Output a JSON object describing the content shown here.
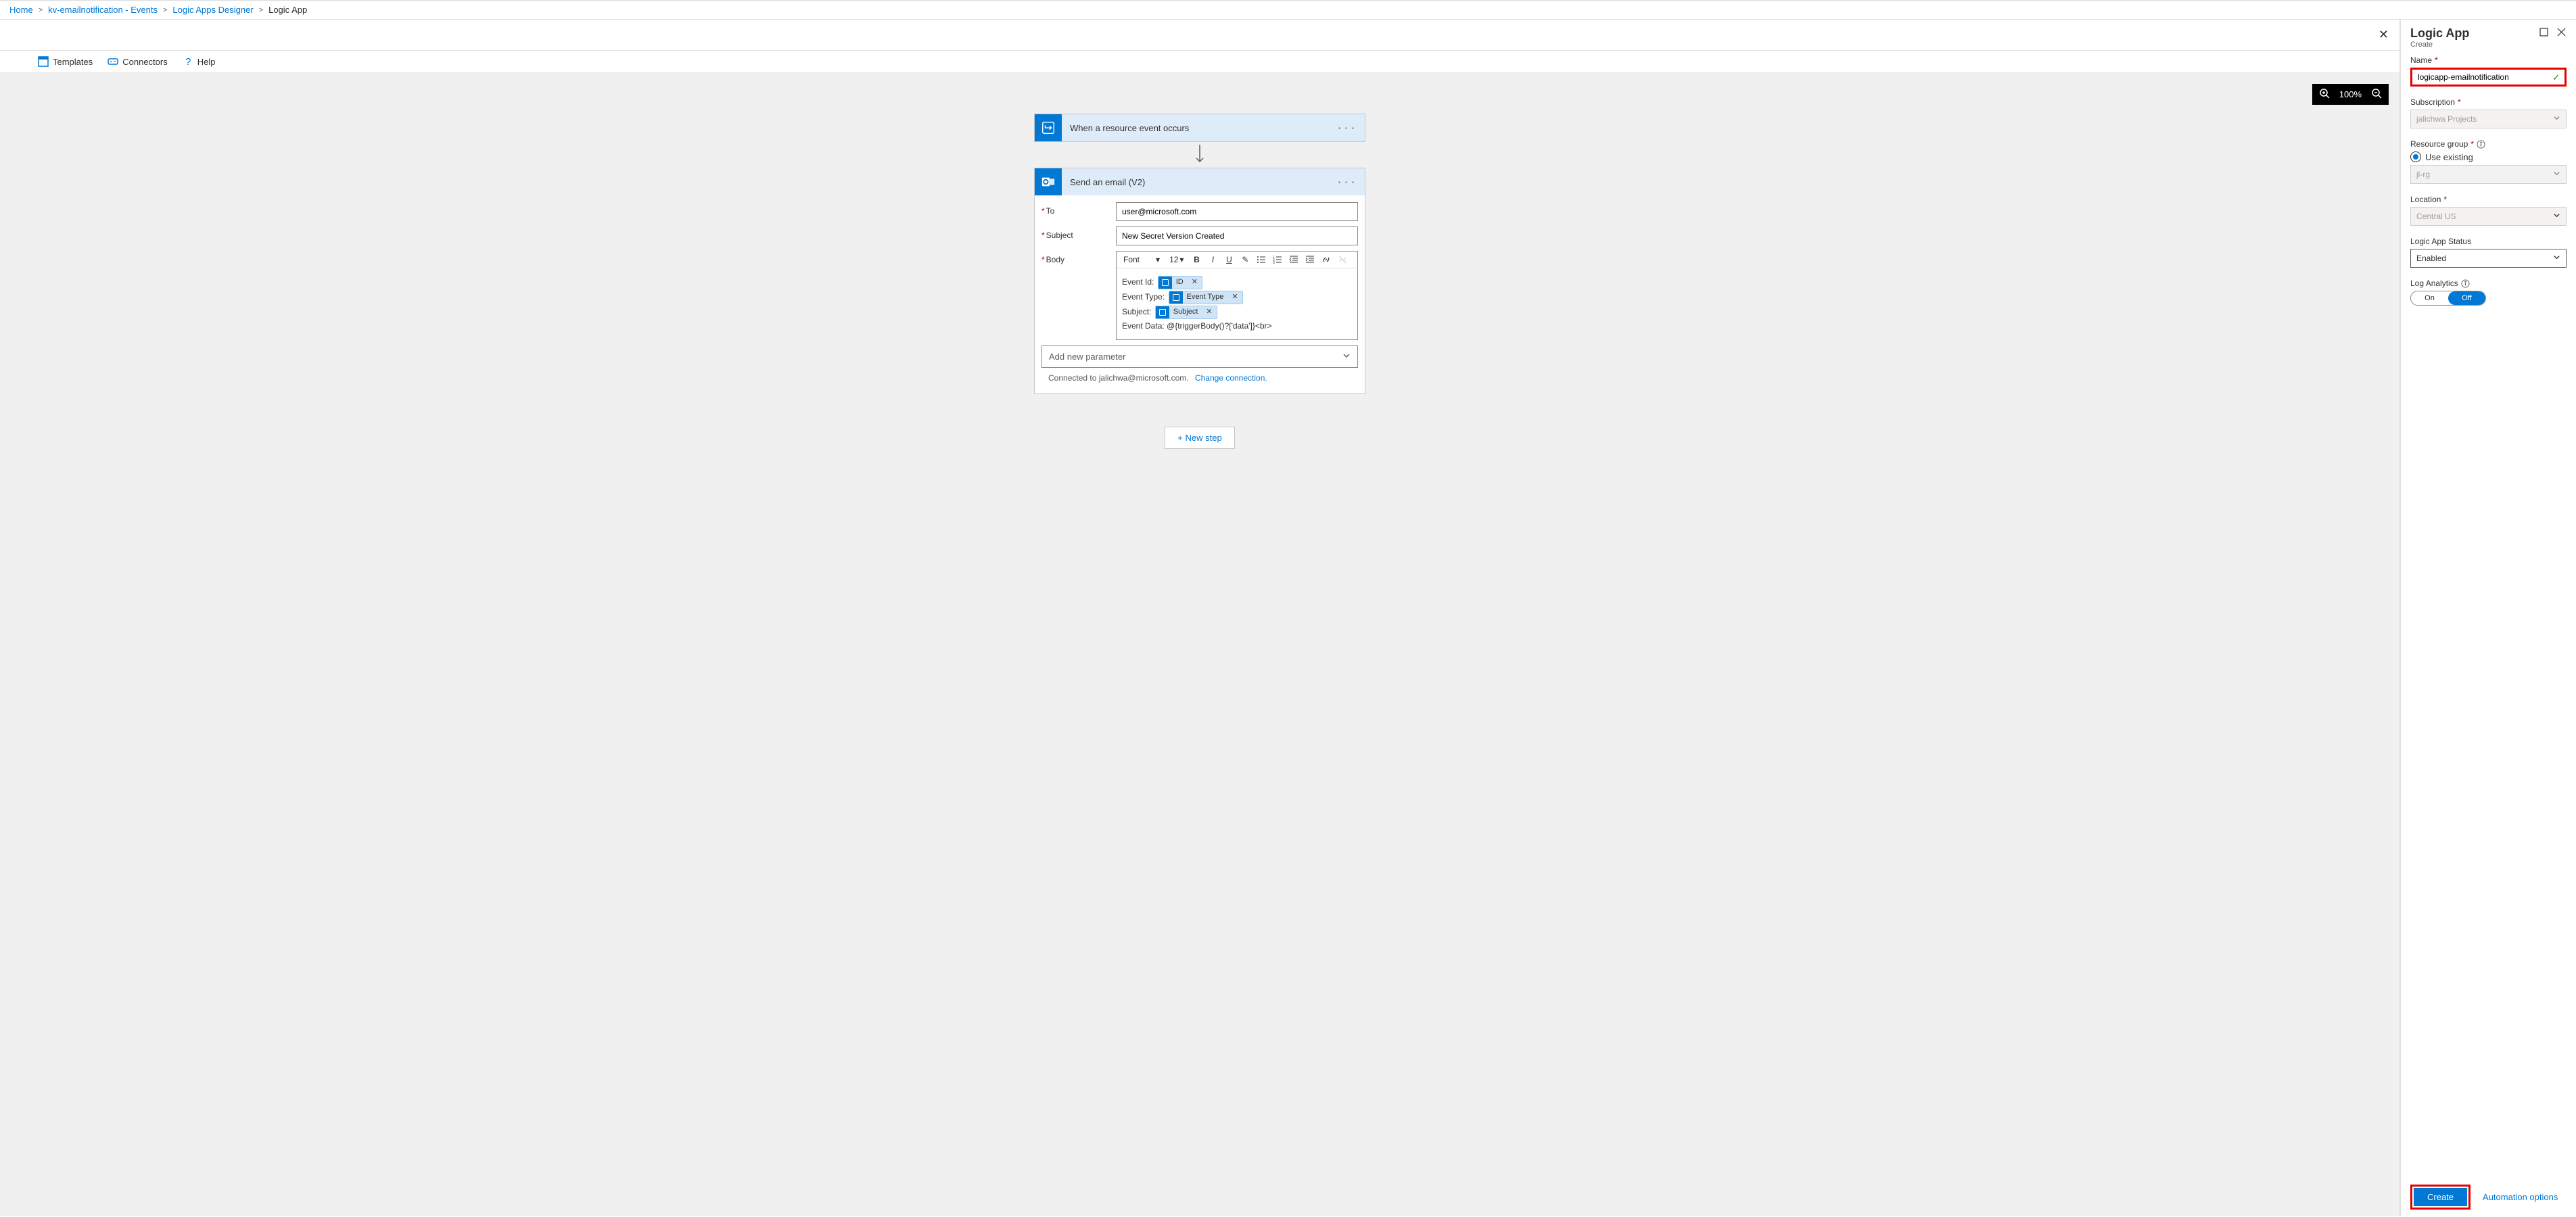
{
  "breadcrumb": {
    "items": [
      {
        "label": "Home",
        "link": true
      },
      {
        "label": "kv-emailnotification - Events",
        "link": true
      },
      {
        "label": "Logic Apps Designer",
        "link": true
      },
      {
        "label": "Logic App",
        "link": false
      }
    ]
  },
  "toolbar": {
    "templates": "Templates",
    "connectors": "Connectors",
    "help": "Help"
  },
  "zoom": {
    "level": "100%"
  },
  "flow": {
    "trigger": {
      "title": "When a resource event occurs"
    },
    "action": {
      "title": "Send an email (V2)",
      "fields": {
        "to_label": "To",
        "to_value": "user@microsoft.com",
        "subject_label": "Subject",
        "subject_value": "New Secret Version Created",
        "body_label": "Body"
      },
      "rte": {
        "font_label": "Font",
        "size_label": "12"
      },
      "body_lines": {
        "l1_label": "Event Id:",
        "l1_token": "ID",
        "l2_label": "Event Type:",
        "l2_token": "Event Type",
        "l3_label": "Subject:",
        "l3_token": "Subject",
        "l4_text": "Event Data: @{triggerBody()?['data']}<br>"
      },
      "add_param": "Add new parameter",
      "connected_prefix": "Connected to jalichwa@microsoft.com.",
      "change_conn": "Change connection."
    },
    "new_step": "+ New step"
  },
  "panel": {
    "title": "Logic App",
    "subtitle": "Create",
    "name_label": "Name",
    "name_value": "logicapp-emailnotification",
    "subscription_label": "Subscription",
    "subscription_value": "jalichwa Projects",
    "rg_label": "Resource group",
    "rg_radio": "Use existing",
    "rg_value": "jl-rg",
    "location_label": "Location",
    "location_value": "Central US",
    "status_label": "Logic App Status",
    "status_value": "Enabled",
    "log_label": "Log Analytics",
    "toggle_on": "On",
    "toggle_off": "Off",
    "create_btn": "Create",
    "automation": "Automation options"
  }
}
